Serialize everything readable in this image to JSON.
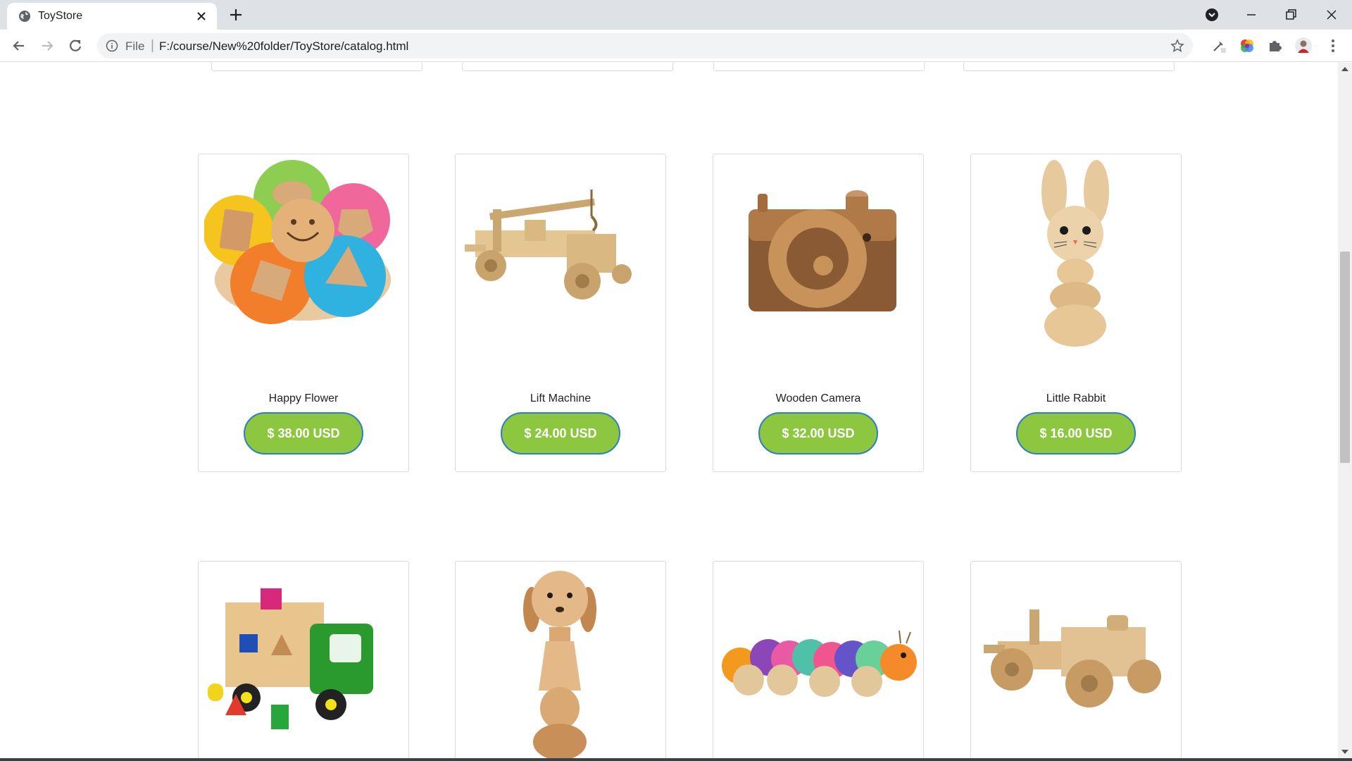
{
  "browser": {
    "tab_title": "ToyStore",
    "url_scheme": "File",
    "url": "F:/course/New%20folder/ToyStore/catalog.html"
  },
  "catalog": {
    "row1": [
      {
        "name": "Happy Flower",
        "price": "$ 38.00 USD",
        "image": "stacking-flower-toy"
      },
      {
        "name": "Lift Machine",
        "price": "$ 24.00 USD",
        "image": "wooden-crane-truck"
      },
      {
        "name": "Wooden Camera",
        "price": "$ 32.00 USD",
        "image": "wooden-camera"
      },
      {
        "name": "Little Rabbit",
        "price": "$ 16.00 USD",
        "image": "stacking-rabbit"
      }
    ],
    "row2": [
      {
        "image": "shape-sorter-truck"
      },
      {
        "image": "stacking-dog"
      },
      {
        "image": "caterpillar-pull-toy"
      },
      {
        "image": "wooden-tractor"
      }
    ]
  },
  "colors": {
    "price_button": "#8dc63f",
    "price_button_border": "#2d7ec4"
  }
}
